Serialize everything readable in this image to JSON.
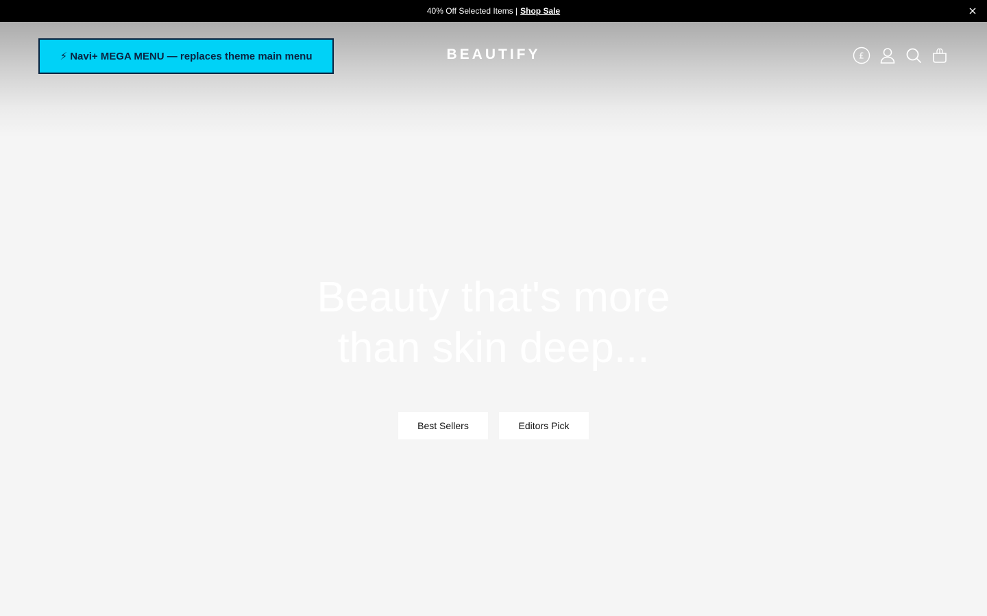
{
  "announcement": {
    "text": "40% Off Selected Items |",
    "link_label": "Shop Sale",
    "background": "#000000"
  },
  "header": {
    "mega_menu_label": "⚡ Navi+ MEGA MENU — replaces theme main menu",
    "mega_menu_color": "#00d2f7",
    "logo": "BEAUTIFY",
    "icons": [
      "currency-icon",
      "account-icon",
      "search-icon",
      "cart-icon"
    ],
    "currency_symbol": "£"
  },
  "hero": {
    "title_line1": "Beauty that's more",
    "title_line2": "than skin deep...",
    "buttons": [
      {
        "label": "Best Sellers"
      },
      {
        "label": "Editors Pick"
      }
    ]
  }
}
